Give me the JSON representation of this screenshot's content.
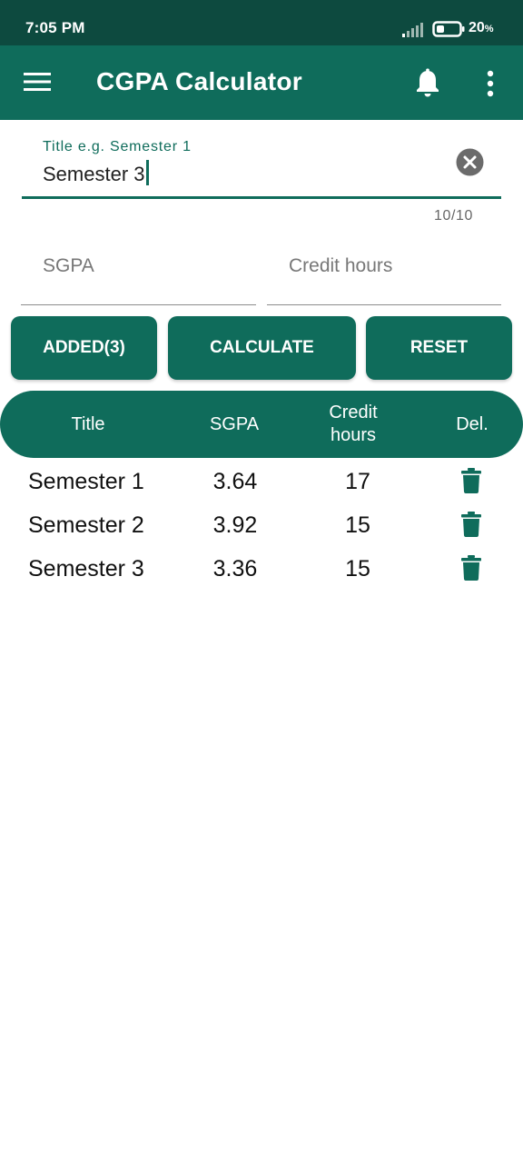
{
  "status_bar": {
    "time": "7:05 PM",
    "battery_level": "20",
    "battery_unit": "%"
  },
  "app_bar": {
    "title": "CGPA Calculator",
    "icons": [
      "menu-icon",
      "bell-icon",
      "more-vert-icon"
    ]
  },
  "form": {
    "title_label": "Title e.g. Semester 1",
    "title_value": "Semester 3",
    "char_counter": "10/10",
    "sgpa_placeholder": "SGPA",
    "credit_placeholder": "Credit hours"
  },
  "buttons": {
    "added": "ADDED(3)",
    "calculate": "CALCULATE",
    "reset": "RESET"
  },
  "table": {
    "headers": {
      "title": "Title",
      "sgpa": "SGPA",
      "credit": "Credit\nhours",
      "delete": "Del."
    },
    "rows": [
      {
        "title": "Semester 1",
        "sgpa": "3.64",
        "credit_hours": "17"
      },
      {
        "title": "Semester 2",
        "sgpa": "3.92",
        "credit_hours": "15"
      },
      {
        "title": "Semester 3",
        "sgpa": "3.36",
        "credit_hours": "15"
      }
    ]
  },
  "colors": {
    "status_bar": "#0d4a3f",
    "primary": "#0f6c5b",
    "background": "#ffffff",
    "text": "#111111"
  }
}
